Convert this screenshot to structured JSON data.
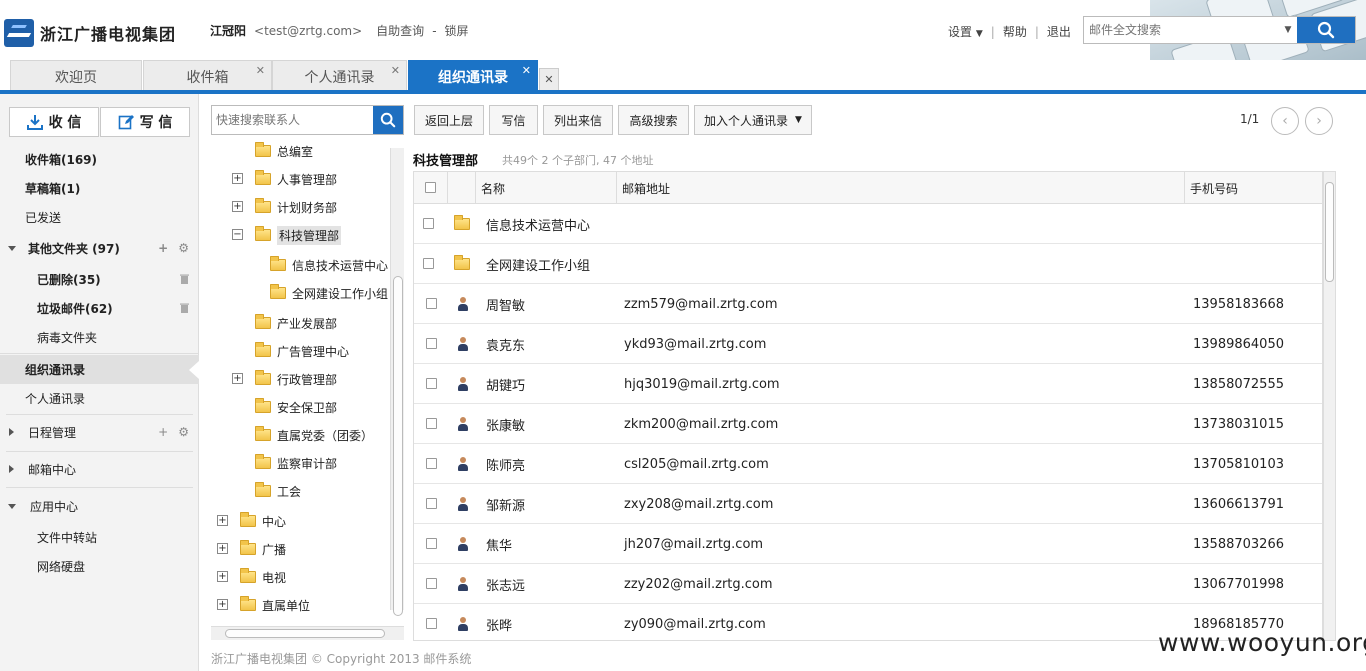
{
  "header": {
    "logo_text": "浙江广播电视集团",
    "user_name": "江冠阳",
    "user_email": "<test@zrtg.com>",
    "self_query": "自助查询",
    "dash": "-",
    "lock": "锁屏",
    "settings": "设置",
    "help": "帮助",
    "logout": "退出",
    "sep": "|",
    "search_placeholder": "邮件全文搜索"
  },
  "tabs": [
    {
      "label": "欢迎页",
      "closable": false,
      "active": false
    },
    {
      "label": "收件箱",
      "closable": true,
      "active": false
    },
    {
      "label": "个人通讯录",
      "closable": true,
      "active": false
    },
    {
      "label": "组织通讯录",
      "closable": true,
      "active": true
    }
  ],
  "tab_close_glyph": "✕",
  "sidebar": {
    "receive_label": "收 信",
    "write_label": "写 信",
    "items": [
      {
        "label": "收件箱(169)"
      },
      {
        "label": "草稿箱(1)"
      },
      {
        "label": "已发送"
      },
      {
        "label": "其他文件夹 (97)"
      },
      {
        "label": "已删除(35)"
      },
      {
        "label": "垃圾邮件(62)"
      },
      {
        "label": "病毒文件夹"
      },
      {
        "label": "组织通讯录"
      },
      {
        "label": "个人通讯录"
      },
      {
        "label": "日程管理"
      },
      {
        "label": "邮箱中心"
      },
      {
        "label": "应用中心"
      },
      {
        "label": "文件中转站"
      },
      {
        "label": "网络硬盘"
      }
    ],
    "plus": "+",
    "gear": "⚙"
  },
  "tree": {
    "search_placeholder": "快速搜索联系人",
    "nodes": [
      {
        "label": "总编室"
      },
      {
        "label": "人事管理部"
      },
      {
        "label": "计划财务部"
      },
      {
        "label": "科技管理部"
      },
      {
        "label": "信息技术运营中心"
      },
      {
        "label": "全网建设工作小组"
      },
      {
        "label": "产业发展部"
      },
      {
        "label": "广告管理中心"
      },
      {
        "label": "行政管理部"
      },
      {
        "label": "安全保卫部"
      },
      {
        "label": "直属党委（团委）"
      },
      {
        "label": "监察审计部"
      },
      {
        "label": "工会"
      },
      {
        "label": "中心"
      },
      {
        "label": "广播"
      },
      {
        "label": "电视"
      },
      {
        "label": "直属单位"
      }
    ],
    "plus": "+",
    "minus": "−"
  },
  "toolbar": {
    "back": "返回上层",
    "write": "写信",
    "list_mail": "列出来信",
    "adv_search": "高级搜索",
    "add_personal": "加入个人通讯录",
    "page": "1/1",
    "prev": "‹",
    "next": "›"
  },
  "content": {
    "dept_name": "科技管理部",
    "dept_stats": "共49个 2 个子部门, 47 个地址",
    "columns": {
      "name": "名称",
      "email": "邮箱地址",
      "phone": "手机号码"
    },
    "folders": [
      {
        "name": "信息技术运营中心"
      },
      {
        "name": "全网建设工作小组"
      }
    ],
    "people": [
      {
        "name": "周智敏",
        "email": "zzm579@mail.zrtg.com",
        "phone": "13958183668"
      },
      {
        "name": "袁克东",
        "email": "ykd93@mail.zrtg.com",
        "phone": "13989864050"
      },
      {
        "name": "胡键巧",
        "email": "hjq3019@mail.zrtg.com",
        "phone": "13858072555"
      },
      {
        "name": "张康敏",
        "email": "zkm200@mail.zrtg.com",
        "phone": "13738031015"
      },
      {
        "name": "陈师亮",
        "email": "csl205@mail.zrtg.com",
        "phone": "13705810103"
      },
      {
        "name": "邹新源",
        "email": "zxy208@mail.zrtg.com",
        "phone": "13606613791"
      },
      {
        "name": "焦华",
        "email": "jh207@mail.zrtg.com",
        "phone": "13588703266"
      },
      {
        "name": "张志远",
        "email": "zzy202@mail.zrtg.com",
        "phone": "13067701998"
      },
      {
        "name": "张晔",
        "email": "zy090@mail.zrtg.com",
        "phone": "18968185770"
      }
    ]
  },
  "footer": "浙江广播电视集团 © Copyright 2013 邮件系统",
  "watermark": "www.wooyun.org",
  "colors": {
    "accent": "#1b73c6",
    "search_button": "#1f6fc0"
  }
}
